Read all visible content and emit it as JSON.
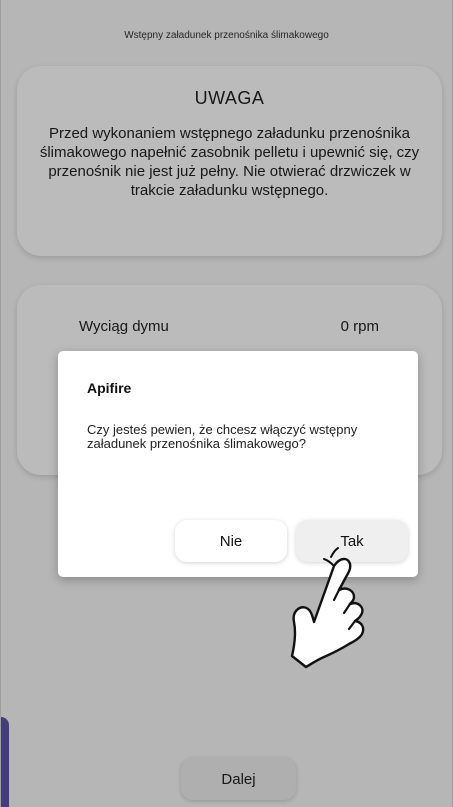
{
  "header": {
    "title": "Wstępny załadunek przenośnika ślimakowego"
  },
  "warning": {
    "title": "UWAGA",
    "text": "Przed wykonaniem wstępnego załadunku przenośnika ślimakowego napełnić zasobnik pelletu i upewnić się, czy przenośnik nie jest już pełny. Nie otwierać drzwiczek w trakcie załadunku wstępnego."
  },
  "fan": {
    "label": "Wyciąg dymu",
    "value": "0 rpm"
  },
  "footer": {
    "next_label": "Dalej"
  },
  "dialog": {
    "title": "Apifire",
    "message": "Czy jesteś pewien, że chcesz włączyć wstępny załadunek przenośnika ślimakowego?",
    "no_label": "Nie",
    "yes_label": "Tak"
  },
  "colors": {
    "accent": "#5b4fa6",
    "background": "#efefef",
    "card": "#f6f6f6"
  }
}
